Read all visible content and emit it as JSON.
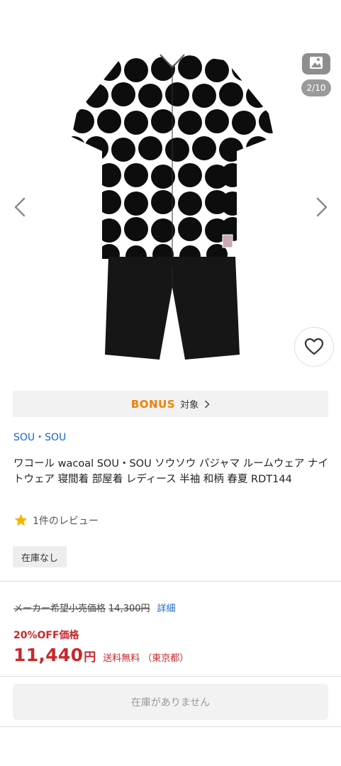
{
  "gallery": {
    "counter": "2/10",
    "icons": {
      "gallery": "image-gallery-icon",
      "prev": "chevron-left-icon",
      "next": "chevron-right-icon",
      "favorite": "heart-icon"
    }
  },
  "bonus": {
    "logo": "BONUS",
    "label": "対象"
  },
  "product": {
    "brand": "SOU・SOU",
    "title": "ワコール wacoal SOU・SOU ソウソウ パジャマ ルームウェア ナイトウェア 寝間着 部屋着 レディース 半袖 和柄 春夏 RDT144",
    "rating_stars": 1,
    "review_text": "1件のレビュー",
    "stock_badge": "在庫なし"
  },
  "pricing": {
    "msrp_label": "メーカー希望小売価格",
    "msrp_price": "14,300円",
    "detail_link": "詳細",
    "discount_label": "20%OFF価格",
    "price": "11,440",
    "price_unit": "円",
    "shipping": "送料無料",
    "shipping_area": "（東京都）"
  },
  "cart_button": "在庫がありません",
  "colors": {
    "accent_red": "#c8282d",
    "link_blue": "#1a66c8",
    "bonus_orange": "#f08000",
    "star_yellow": "#f5b400"
  }
}
